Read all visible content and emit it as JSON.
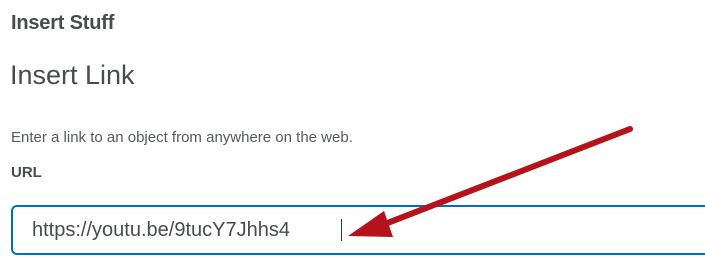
{
  "dialog": {
    "title": "Insert Stuff"
  },
  "insert_link": {
    "heading": "Insert Link",
    "description": "Enter a link to an object from anywhere on the web.",
    "url_label": "URL",
    "url_value": "https://youtu.be/9tucY7Jhhs4"
  },
  "colors": {
    "input_focus_border": "#006fbf",
    "annotation_arrow": "#b5121b",
    "text": "#494c4e"
  },
  "icons": {
    "annotation": "red-arrow-icon"
  }
}
